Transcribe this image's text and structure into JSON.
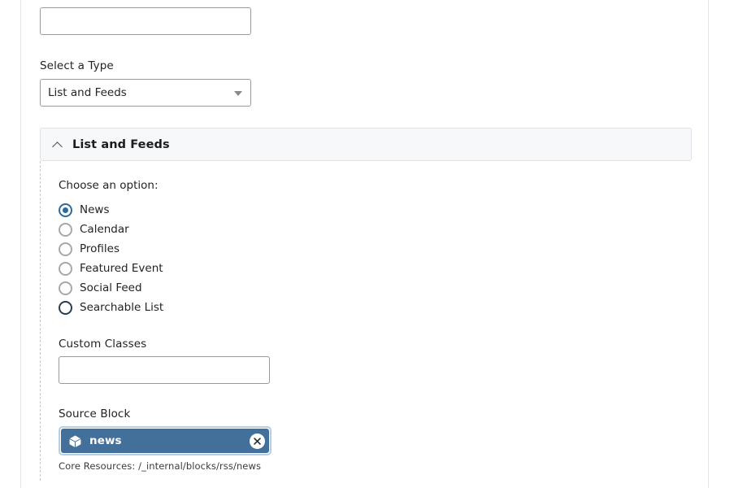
{
  "form": {
    "title_field": {
      "value": "",
      "placeholder": ""
    },
    "type_field": {
      "label": "Select a Type",
      "selected": "List and Feeds",
      "options": [
        "List and Feeds"
      ],
      "caret_icon": "chevron-down-icon"
    }
  },
  "accordion": {
    "title": "List and Feeds",
    "expanded": true,
    "toggle_icon": "chevron-up-icon"
  },
  "option_group": {
    "label": "Choose an option:",
    "options": [
      {
        "label": "News",
        "state": "checked"
      },
      {
        "label": "Calendar",
        "state": "unchecked"
      },
      {
        "label": "Profiles",
        "state": "unchecked"
      },
      {
        "label": "Featured Event",
        "state": "unchecked"
      },
      {
        "label": "Social Feed",
        "state": "unchecked"
      },
      {
        "label": "Searchable List",
        "state": "focused"
      }
    ]
  },
  "custom_classes": {
    "label": "Custom Classes",
    "value": "",
    "placeholder": ""
  },
  "source_block": {
    "label": "Source Block",
    "chip": {
      "icon": "cube-icon",
      "text": "news",
      "remove_icon": "close-icon"
    },
    "caption": "Core Resources: /_internal/blocks/rss/news"
  },
  "colors": {
    "accent_blue": "#2c6b9e",
    "chip_blue": "#42709a",
    "chip_focus_ring": "#b6cfe2",
    "header_bg": "#f7f8fa",
    "header_border": "#dfe2e6",
    "input_border": "#9a9a9a",
    "dashed_border": "#c8c9cb",
    "focus_navy": "#2a3c50"
  }
}
